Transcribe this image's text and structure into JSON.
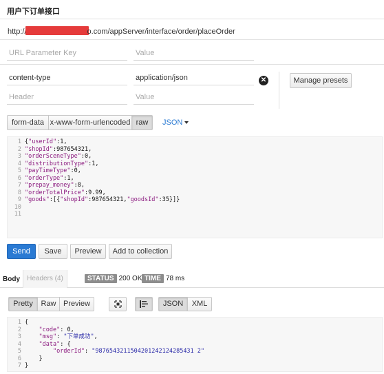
{
  "page": {
    "title": "用户下订单接口"
  },
  "request": {
    "url_prefix": "http://",
    "url_suffix": "o.com/appServer/interface/order/placeOrder",
    "url_params": {
      "key_placeholder": "URL Parameter Key",
      "value_placeholder": "Value"
    },
    "headers": [
      {
        "key": "content-type",
        "value": "application/json"
      }
    ],
    "header_placeholder": {
      "key": "Header",
      "value": "Value"
    },
    "manage_presets": "Manage presets",
    "body_modes": [
      "form-data",
      "x-www-form-urlencoded",
      "raw"
    ],
    "active_body_mode": "raw",
    "format_dropdown": "JSON",
    "body_lines": [
      {
        "n": "1",
        "parts": [
          [
            "p",
            "{"
          ],
          [
            "k",
            "\"userId\""
          ],
          [
            "p",
            ":1,"
          ]
        ]
      },
      {
        "n": "2",
        "parts": [
          [
            "k",
            "\"shopId\""
          ],
          [
            "p",
            ":987654321,"
          ]
        ]
      },
      {
        "n": "3",
        "parts": [
          [
            "k",
            "\"orderSceneType\""
          ],
          [
            "p",
            ":0,"
          ]
        ]
      },
      {
        "n": "4",
        "parts": [
          [
            "k",
            "\"distributionType\""
          ],
          [
            "p",
            ":1,"
          ]
        ]
      },
      {
        "n": "5",
        "parts": [
          [
            "k",
            "\"payTimeType\""
          ],
          [
            "p",
            ":0,"
          ]
        ]
      },
      {
        "n": "6",
        "parts": [
          [
            "k",
            "\"orderType\""
          ],
          [
            "p",
            ":1,"
          ]
        ]
      },
      {
        "n": "7",
        "parts": [
          [
            "k",
            "\"prepay_money\""
          ],
          [
            "p",
            ":8,"
          ]
        ]
      },
      {
        "n": "8",
        "parts": [
          [
            "k",
            "\"orderTotalPrice\""
          ],
          [
            "p",
            ":9.99,"
          ]
        ]
      },
      {
        "n": "9",
        "parts": [
          [
            "k",
            "\"goods\""
          ],
          [
            "p",
            ":[{"
          ],
          [
            "k",
            "\"shopId\""
          ],
          [
            "p",
            ":987654321,"
          ],
          [
            "k",
            "\"goodsId\""
          ],
          [
            "p",
            ":35}]}"
          ]
        ]
      },
      {
        "n": "10",
        "parts": []
      },
      {
        "n": "11",
        "parts": []
      }
    ],
    "actions": {
      "send": "Send",
      "save": "Save",
      "preview": "Preview",
      "add_to_collection": "Add to collection"
    }
  },
  "response": {
    "tabs": {
      "body": "Body",
      "headers": "Headers (4)"
    },
    "status_label": "STATUS",
    "status_value": "200 OK",
    "time_label": "TIME",
    "time_value": "78 ms",
    "view_modes": [
      "Pretty",
      "Raw",
      "Preview"
    ],
    "active_view_mode": "Pretty",
    "format_modes": [
      "JSON",
      "XML"
    ],
    "active_format_mode": "JSON",
    "body_lines": [
      {
        "n": "1",
        "parts": [
          [
            "p",
            "{"
          ]
        ]
      },
      {
        "n": "2",
        "parts": [
          [
            "p",
            "    "
          ],
          [
            "k",
            "\"code\""
          ],
          [
            "p",
            ": "
          ],
          [
            "p",
            "0"
          ],
          [
            "p",
            ","
          ]
        ]
      },
      {
        "n": "3",
        "parts": [
          [
            "p",
            "    "
          ],
          [
            "k",
            "\"msg\""
          ],
          [
            "p",
            ": "
          ],
          [
            "s",
            "\"下单成功\""
          ],
          [
            "p",
            ","
          ]
        ]
      },
      {
        "n": "4",
        "parts": [
          [
            "p",
            "    "
          ],
          [
            "k",
            "\"data\""
          ],
          [
            "p",
            ": {"
          ]
        ]
      },
      {
        "n": "5",
        "parts": [
          [
            "p",
            "        "
          ],
          [
            "k",
            "\"orderId\""
          ],
          [
            "p",
            ": "
          ],
          [
            "s",
            "\"9876543211504201242124285431 2\""
          ]
        ]
      },
      {
        "n": "6",
        "parts": [
          [
            "p",
            "    }"
          ]
        ]
      },
      {
        "n": "7",
        "parts": [
          [
            "p",
            "}"
          ]
        ]
      }
    ]
  },
  "colors": {
    "accent": "#2a7ad3",
    "redaction": "#e53b3b",
    "badge": "#8d8d8d"
  }
}
